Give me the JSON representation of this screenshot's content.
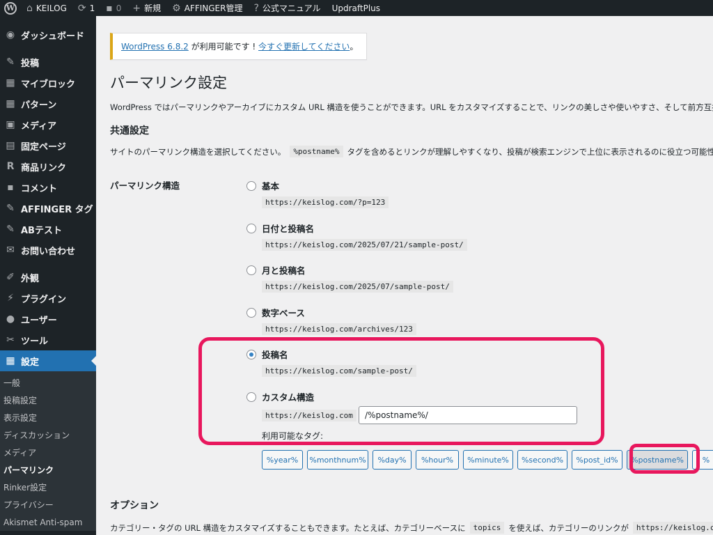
{
  "adminbar": {
    "site_name": "KEILOG",
    "updates_count": "1",
    "comments_count": "0",
    "new_label": "新規",
    "affinger_label": "AFFINGER管理",
    "manual_label": "公式マニュアル",
    "updraft_label": "UpdraftPlus"
  },
  "sidebar": {
    "dashboard": "ダッシュボード",
    "posts": "投稿",
    "myblocks": "マイブロック",
    "patterns": "パターン",
    "media": "メディア",
    "pages": "固定ページ",
    "product_links": "商品リンク",
    "comments": "コメント",
    "affinger_tags": "AFFINGER タグ",
    "ab_test": "ABテスト",
    "contact": "お問い合わせ",
    "appearance": "外観",
    "plugins": "プラグイン",
    "users": "ユーザー",
    "tools": "ツール",
    "settings": "設定",
    "submenu": {
      "general": "一般",
      "writing": "投稿設定",
      "reading": "表示設定",
      "discussion": "ディスカッション",
      "media": "メディア",
      "permalinks": "パーマリンク",
      "rinker": "Rinker設定",
      "privacy": "プライバシー",
      "akismet": "Akismet Anti-spam"
    }
  },
  "notice": {
    "version_link": "WordPress 6.8.2",
    "middle": " が利用可能です ! ",
    "update_link": "今すぐ更新してください",
    "end": "。"
  },
  "page": {
    "title": "パーマリンク設定",
    "description": "WordPress ではパーマリンクやアーカイブにカスタム URL 構造を使うことができます。URL をカスタマイズすることで、リンクの美しさや使いやすさ、そして前方互換",
    "common_heading": "共通設定",
    "common_desc_before": "サイトのパーマリンク構造を選択してください。",
    "common_desc_code": "%postname%",
    "common_desc_after": "タグを含めるとリンクが理解しやすくなり、投稿が検索エンジンで上位に表示されるのに役立つ可能性",
    "structure_label": "パーマリンク構造"
  },
  "options": {
    "plain": {
      "label": "基本",
      "example": "https://keislog.com/?p=123"
    },
    "day_name": {
      "label": "日付と投稿名",
      "example": "https://keislog.com/2025/07/21/sample-post/"
    },
    "month_name": {
      "label": "月と投稿名",
      "example": "https://keislog.com/2025/07/sample-post/"
    },
    "numeric": {
      "label": "数字ベース",
      "example": "https://keislog.com/archives/123"
    },
    "post_name": {
      "label": "投稿名",
      "example": "https://keislog.com/sample-post/"
    },
    "custom": {
      "label": "カスタム構造",
      "prefix": "https://keislog.com",
      "value": "/%postname%/"
    }
  },
  "available_tags_label": "利用可能なタグ:",
  "tags": [
    "%year%",
    "%monthnum%",
    "%day%",
    "%hour%",
    "%minute%",
    "%second%",
    "%post_id%",
    "%postname%",
    "%"
  ],
  "optional": {
    "heading": "オプション",
    "desc_before": "カテゴリー・タグの URL 構造をカスタマイズすることもできます。たとえば、カテゴリーベースに",
    "desc_code1": "topics",
    "desc_middle": "を使えば、カテゴリーのリンクが",
    "desc_code2": "https://keislog.co"
  },
  "colors": {
    "highlight": "#e8175d",
    "accent": "#2271b1",
    "notice_border": "#dba617"
  }
}
